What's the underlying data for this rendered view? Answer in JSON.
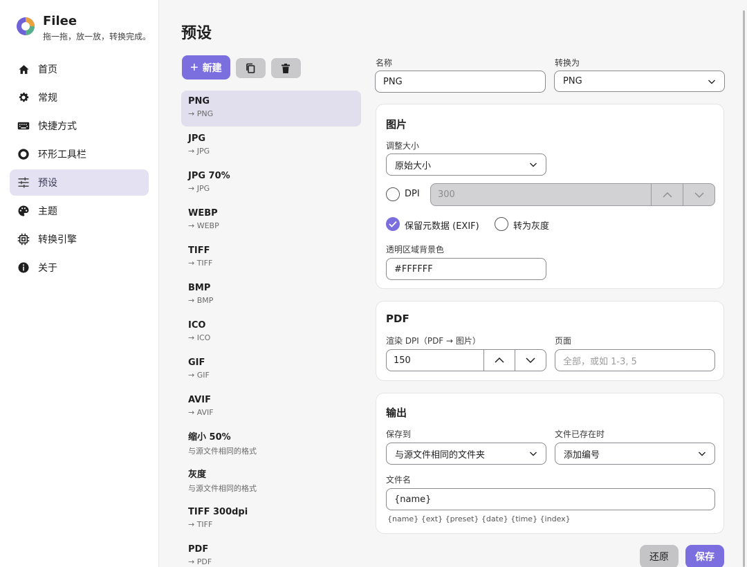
{
  "app": {
    "name": "Filee",
    "tagline": "拖一拖，放一放，转换完成。"
  },
  "sidebar": {
    "items": [
      {
        "label": "首页",
        "icon": "home-icon"
      },
      {
        "label": "常规",
        "icon": "gear-icon"
      },
      {
        "label": "快捷方式",
        "icon": "keyboard-icon"
      },
      {
        "label": "环形工具栏",
        "icon": "ring-icon"
      },
      {
        "label": "预设",
        "icon": "sliders-icon",
        "active": true
      },
      {
        "label": "主题",
        "icon": "palette-icon"
      },
      {
        "label": "转换引擎",
        "icon": "chip-icon"
      },
      {
        "label": "关于",
        "icon": "info-icon"
      }
    ]
  },
  "page": {
    "title": "预设",
    "new_label": "新建"
  },
  "presets": [
    {
      "name": "PNG",
      "target": "→ PNG",
      "active": true
    },
    {
      "name": "JPG",
      "target": "→ JPG"
    },
    {
      "name": "JPG 70%",
      "target": "→ JPG"
    },
    {
      "name": "WEBP",
      "target": "→ WEBP"
    },
    {
      "name": "TIFF",
      "target": "→ TIFF"
    },
    {
      "name": "BMP",
      "target": "→ BMP"
    },
    {
      "name": "ICO",
      "target": "→ ICO"
    },
    {
      "name": "GIF",
      "target": "→ GIF"
    },
    {
      "name": "AVIF",
      "target": "→ AVIF"
    },
    {
      "name": "缩小 50%",
      "target": "与源文件相同的格式"
    },
    {
      "name": "灰度",
      "target": "与源文件相同的格式"
    },
    {
      "name": "TIFF 300dpi",
      "target": "→ TIFF"
    },
    {
      "name": "PDF",
      "target": "→ PDF"
    }
  ],
  "editor": {
    "name_label": "名称",
    "name_value": "PNG",
    "convert_label": "转换为",
    "convert_value": "PNG",
    "image": {
      "title": "图片",
      "resize_label": "调整大小",
      "resize_value": "原始大小",
      "dpi_label": "DPI",
      "dpi_placeholder": "300",
      "keep_exif_label": "保留元数据 (EXIF)",
      "grayscale_label": "转为灰度",
      "bg_label": "透明区域背景色",
      "bg_value": "#FFFFFF"
    },
    "pdf": {
      "title": "PDF",
      "render_dpi_label": "渲染 DPI（PDF → 图片）",
      "render_dpi_value": "150",
      "pages_label": "页面",
      "pages_placeholder": "全部，或如 1-3, 5"
    },
    "output": {
      "title": "输出",
      "save_to_label": "保存到",
      "save_to_value": "与源文件相同的文件夹",
      "exists_label": "文件已存在时",
      "exists_value": "添加编号",
      "filename_label": "文件名",
      "filename_value": "{name}",
      "tokens_hint": "{name} {ext} {preset} {date} {time} {index}"
    },
    "revert_label": "还原",
    "save_label": "保存"
  },
  "colors": {
    "accent": "#7b6fe0",
    "active_bg": "#e4e2f2"
  }
}
